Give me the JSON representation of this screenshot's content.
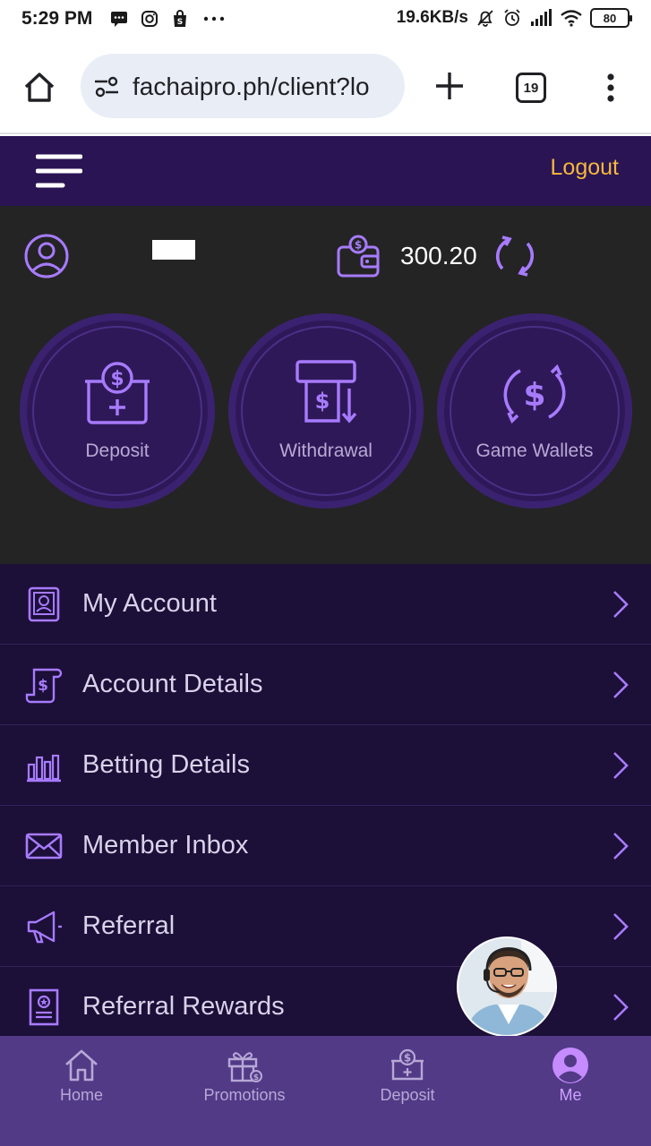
{
  "status_bar": {
    "time": "5:29 PM",
    "network_speed": "19.6KB/s",
    "battery": "80"
  },
  "browser": {
    "url": "fachaipro.ph/client?lo",
    "tab_count": "19"
  },
  "header": {
    "logout_label": "Logout"
  },
  "wallet": {
    "balance": "300.20"
  },
  "actions": [
    {
      "label": "Deposit",
      "icon": "deposit-icon"
    },
    {
      "label": "Withdrawal",
      "icon": "withdrawal-icon"
    },
    {
      "label": "Game Wallets",
      "icon": "game-wallets-icon"
    }
  ],
  "menu": {
    "items": [
      {
        "label": "My Account",
        "icon": "my-account-icon"
      },
      {
        "label": "Account Details",
        "icon": "account-details-icon"
      },
      {
        "label": "Betting Details",
        "icon": "betting-details-icon"
      },
      {
        "label": "Member Inbox",
        "icon": "member-inbox-icon"
      },
      {
        "label": "Referral",
        "icon": "referral-icon"
      },
      {
        "label": "Referral Rewards",
        "icon": "referral-rewards-icon"
      }
    ]
  },
  "bottom_nav": {
    "items": [
      {
        "label": "Home",
        "icon": "home-icon"
      },
      {
        "label": "Promotions",
        "icon": "gift-icon"
      },
      {
        "label": "Deposit",
        "icon": "deposit-icon"
      },
      {
        "label": "Me",
        "icon": "user-icon"
      }
    ],
    "active": "Me"
  },
  "colors": {
    "header_bg": "#2a1453",
    "logout": "#f5b83d",
    "panel_bg": "#242424",
    "accent": "#a77bff",
    "menu_bg": "#1c0f38",
    "nav_bg": "#523a87"
  }
}
